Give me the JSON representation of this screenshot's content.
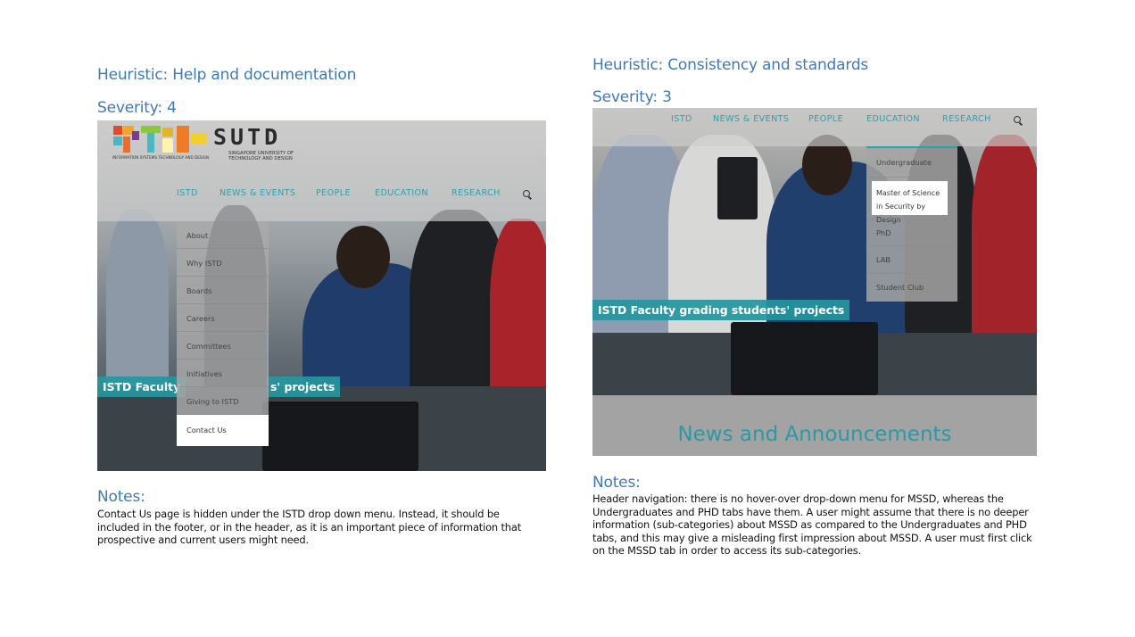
{
  "left": {
    "heuristic": "Heuristic: Help and documentation",
    "severity": "Severity: 4",
    "notes_title": "Notes:",
    "notes_body": "Contact Us page is hidden under the ISTD drop down menu. Instead, it should be included in the footer, or in the header, as it is an important piece of information that prospective and current users might need.",
    "screenshot": {
      "logo_text_sutd": "SUTD",
      "logo_sub_istd": "INFORMATION SYSTEMS TECHNOLOGY AND DESIGN",
      "logo_sub_sutd_1": "SINGAPORE UNIVERSITY OF",
      "logo_sub_sutd_2": "TECHNOLOGY AND DESIGN",
      "nav": [
        "ISTD",
        "NEWS & EVENTS",
        "PEOPLE",
        "EDUCATION",
        "RESEARCH"
      ],
      "dropdown": [
        "About",
        "Why ISTD",
        "Boards",
        "Careers",
        "Committees",
        "Initiatives",
        "Giving to ISTD",
        "Contact Us"
      ],
      "highlighted_item": "Contact Us",
      "caption_left": "ISTD Faculty",
      "caption_right": "s' projects"
    }
  },
  "right": {
    "heuristic": "Heuristic: Consistency and standards",
    "severity": "Severity: 3",
    "notes_title": "Notes:",
    "notes_body": "Header navigation: there is no hover-over drop-down menu for MSSD, whereas the Undergraduates and PHD tabs have them. A user might assume that there is no deeper information (sub-categories) about MSSD as compared to the Undergraduates and PHD tabs, and this may give a misleading first impression about MSSD. A user must first click on the MSSD tab in order to access its sub-categories.",
    "screenshot": {
      "nav": [
        "ISTD",
        "NEWS & EVENTS",
        "PEOPLE",
        "EDUCATION",
        "RESEARCH"
      ],
      "dropdown": [
        "Undergraduate",
        "Master of Science in Security by Design",
        "PhD",
        "LAB",
        "Student Club"
      ],
      "highlighted_item": "Master of Science in Security by Design",
      "caption": "ISTD Faculty grading students' projects",
      "section_title": "News and Announcements"
    }
  },
  "colors": {
    "heading_blue": "#3d7ab8",
    "teal_accent": "#2aa2ae",
    "caption_teal": "#2596a0"
  }
}
